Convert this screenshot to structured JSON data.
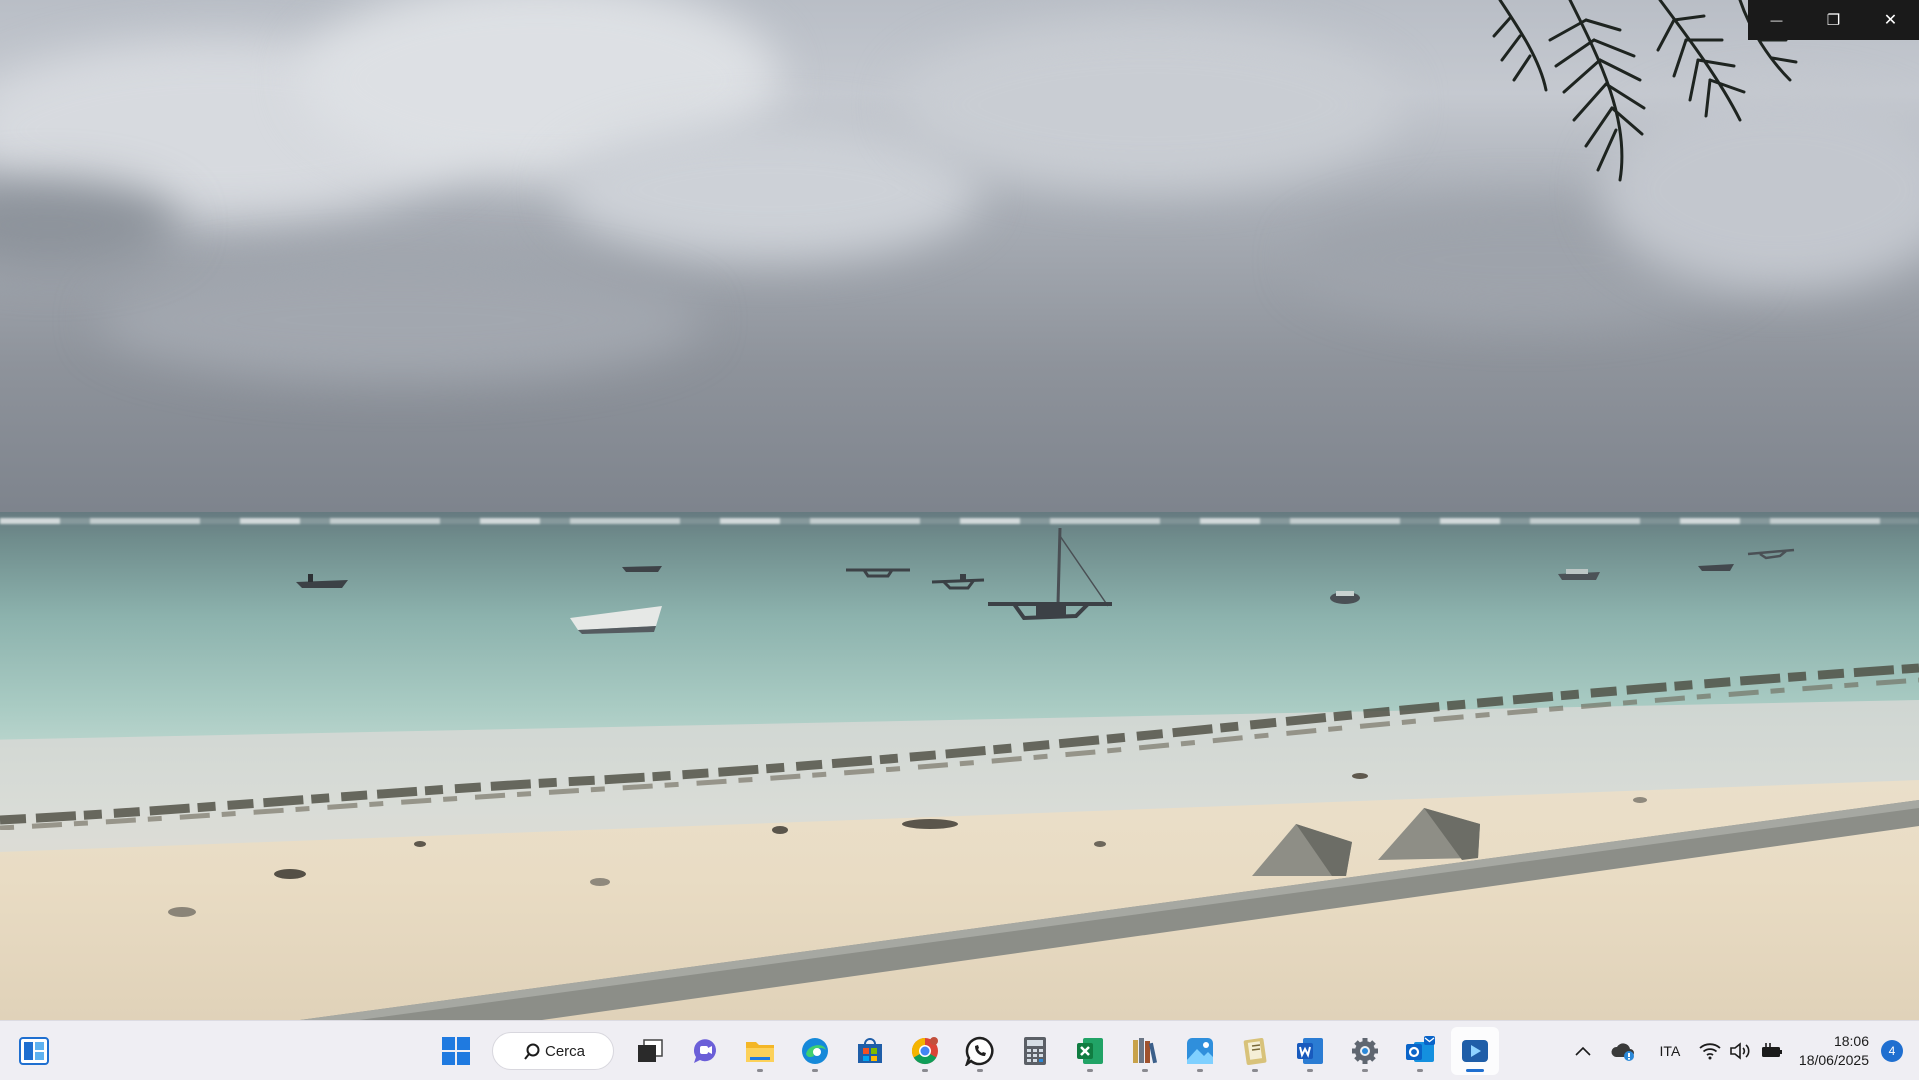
{
  "window_controls": {
    "minimize_glyph": "—",
    "restore_glyph": "❐",
    "close_glyph": "✕"
  },
  "taskbar": {
    "start_icon": "widgets-icon",
    "search": {
      "label": "Cerca"
    },
    "apps": [
      {
        "name": "windows-start",
        "icon": "windows-logo-icon"
      },
      {
        "name": "task-view",
        "icon": "task-view-icon"
      },
      {
        "name": "teams-chat",
        "icon": "chat-icon"
      },
      {
        "name": "file-explorer",
        "icon": "folder-icon"
      },
      {
        "name": "edge",
        "icon": "edge-icon"
      },
      {
        "name": "microsoft-store",
        "icon": "store-icon"
      },
      {
        "name": "chrome",
        "icon": "chrome-icon"
      },
      {
        "name": "whatsapp",
        "icon": "whatsapp-icon"
      },
      {
        "name": "calculator",
        "icon": "calculator-icon"
      },
      {
        "name": "excel",
        "icon": "excel-icon"
      },
      {
        "name": "library",
        "icon": "books-icon"
      },
      {
        "name": "photos",
        "icon": "photos-icon"
      },
      {
        "name": "notebook",
        "icon": "notebook-icon"
      },
      {
        "name": "word",
        "icon": "word-icon"
      },
      {
        "name": "settings",
        "icon": "gear-icon"
      },
      {
        "name": "outlook",
        "icon": "outlook-icon"
      },
      {
        "name": "media-player",
        "icon": "play-icon"
      }
    ],
    "tray": {
      "language": "ITA",
      "time": "18:06",
      "date": "18/06/2025",
      "notification_count": "4"
    }
  },
  "colors": {
    "taskbar_bg": "#efeef3",
    "accent": "#1f6fd0",
    "window_controls_bg": "#1a1a1a"
  }
}
